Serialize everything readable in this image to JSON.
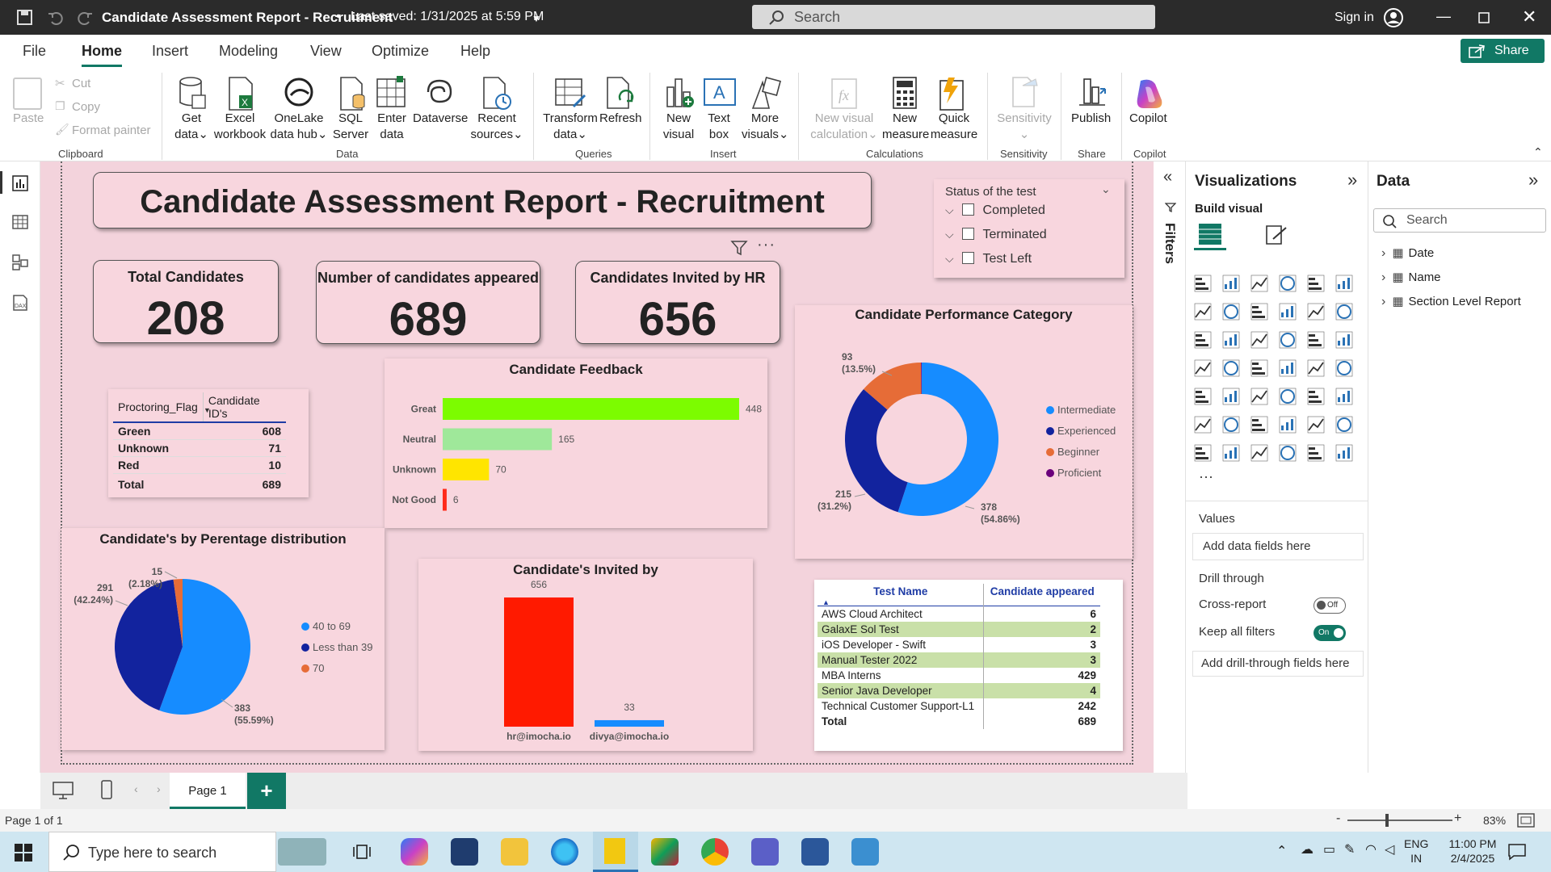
{
  "window": {
    "title": "Candidate Assessment Report - Recruitment",
    "saved": "Last saved: 1/31/2025 at 5:59 PM",
    "search_placeholder": "Search",
    "sign_in": "Sign in"
  },
  "menu": {
    "items": [
      "File",
      "Home",
      "Insert",
      "Modeling",
      "View",
      "Optimize",
      "Help"
    ],
    "share": "Share"
  },
  "ribbon": {
    "clipboard": {
      "paste": "Paste",
      "cut": "Cut",
      "copy": "Copy",
      "format_painter": "Format painter",
      "group": "Clipboard"
    },
    "data": {
      "group": "Data",
      "get_data_1": "Get",
      "get_data_2": "data",
      "excel_1": "Excel",
      "excel_2": "workbook",
      "onelake_1": "OneLake",
      "onelake_2": "data hub",
      "sql_1": "SQL",
      "sql_2": "Server",
      "enter_1": "Enter",
      "enter_2": "data",
      "dataverse": "Dataverse",
      "recent_1": "Recent",
      "recent_2": "sources"
    },
    "queries": {
      "group": "Queries",
      "transform_1": "Transform",
      "transform_2": "data",
      "refresh": "Refresh"
    },
    "insert": {
      "group": "Insert",
      "new_visual_1": "New",
      "new_visual_2": "visual",
      "text_box_1": "Text",
      "text_box_2": "box",
      "more_visuals_1": "More",
      "more_visuals_2": "visuals"
    },
    "calculations": {
      "group": "Calculations",
      "new_calc_1": "New visual",
      "new_calc_2": "calculation",
      "new_measure_1": "New",
      "new_measure_2": "measure",
      "quick_measure_1": "Quick",
      "quick_measure_2": "measure"
    },
    "sensitivity": {
      "group": "Sensitivity",
      "label": "Sensitivity"
    },
    "share": {
      "group": "Share",
      "publish": "Publish"
    },
    "copilot": {
      "group": "Copilot",
      "label": "Copilot"
    }
  },
  "report": {
    "title": "Candidate Assessment Report - Recruitment",
    "kpis": [
      {
        "label": "Total Candidates",
        "value": "208"
      },
      {
        "label": "Number of candidates appeared",
        "value": "689"
      },
      {
        "label": "Candidates Invited by HR",
        "value": "656"
      }
    ],
    "slicer": {
      "title": "Status of the test",
      "options": [
        "Completed",
        "Terminated",
        "Test Left"
      ]
    },
    "proctoring_table": {
      "headers": [
        "Proctoring_Flag",
        "Candidate ID's"
      ],
      "rows": [
        [
          "Green",
          "608"
        ],
        [
          "Unknown",
          "71"
        ],
        [
          "Red",
          "10"
        ]
      ],
      "total": [
        "Total",
        "689"
      ]
    },
    "test_table": {
      "headers": [
        "Test Name",
        "Candidate appeared"
      ],
      "rows": [
        [
          "AWS Cloud Architect",
          "6"
        ],
        [
          "GalaxE Sol Test",
          "2"
        ],
        [
          "iOS Developer - Swift",
          "3"
        ],
        [
          "Manual Tester 2022",
          "3"
        ],
        [
          "MBA Interns",
          "429"
        ],
        [
          "Senior Java Developer",
          "4"
        ],
        [
          "Technical Customer Support-L1",
          "242"
        ]
      ],
      "total": [
        "Total",
        "689"
      ]
    }
  },
  "chart_data": [
    {
      "type": "bar",
      "title": "Candidate Feedback",
      "categories": [
        "Great",
        "Neutral",
        "Unknown",
        "Not Good"
      ],
      "values": [
        448,
        165,
        70,
        6
      ],
      "colors": [
        "#7cfc00",
        "#9fe89a",
        "#ffe500",
        "#ff2a1a"
      ],
      "orientation": "horizontal"
    },
    {
      "type": "pie",
      "variant": "donut",
      "title": "Candidate Performance Category",
      "categories": [
        "Intermediate",
        "Experienced",
        "Beginner",
        "Proficient"
      ],
      "values": [
        378,
        215,
        93,
        1
      ],
      "labels": [
        "378 (54.86%)",
        "215 (31.2%)",
        "93 (13.5%)",
        ""
      ],
      "colors": [
        "#168cff",
        "#12239e",
        "#e66c37",
        "#6b007b"
      ],
      "legend": "right"
    },
    {
      "type": "pie",
      "title": "Candidate's by Perentage distribution",
      "categories": [
        "40 to 69",
        "Less than 39",
        "70"
      ],
      "values": [
        383,
        291,
        15
      ],
      "labels": [
        "383 (55.59%)",
        "291 (42.24%)",
        "15 (2.18%)"
      ],
      "colors": [
        "#168cff",
        "#12239e",
        "#e66c37"
      ],
      "legend": "right"
    },
    {
      "type": "bar",
      "title": "Candidate's Invited by",
      "categories": [
        "hr@imocha.io",
        "divya@imocha.io"
      ],
      "values": [
        656,
        33
      ],
      "colors": [
        "#ff1a00",
        "#168cff"
      ],
      "orientation": "vertical"
    }
  ],
  "panes": {
    "filters": "Filters",
    "visualizations": {
      "title": "Visualizations",
      "build_visual": "Build visual",
      "values": "Values",
      "add_data": "Add data fields here",
      "drill_through": "Drill through",
      "cross_report": "Cross-report",
      "cross_state": "Off",
      "keep_filters": "Keep all filters",
      "keep_state": "On",
      "add_drill": "Add drill-through fields here"
    },
    "data": {
      "title": "Data",
      "search_placeholder": "Search",
      "tables": [
        "Date",
        "Name",
        "Section Level Report"
      ]
    }
  },
  "pages": {
    "tabs": [
      "Page 1"
    ]
  },
  "status": {
    "page": "Page 1 of 1",
    "zoom": "83%"
  },
  "taskbar": {
    "search_placeholder": "Type here to search",
    "lang_1": "ENG",
    "lang_2": "IN",
    "time": "11:00 PM",
    "date": "2/4/2025"
  },
  "colors": {
    "accent": "#117865",
    "canvas": "#f3d3dc",
    "visual_bg": "#f8d6de"
  }
}
